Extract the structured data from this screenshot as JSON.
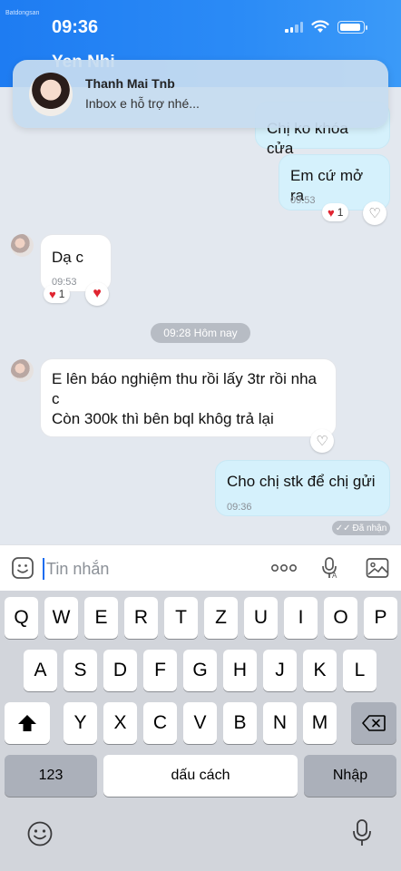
{
  "status_bar": {
    "brand": "Batdongsan",
    "time": "09:36"
  },
  "header": {
    "title": "Yen Nhi"
  },
  "notification": {
    "sender": "Thanh Mai Tnb",
    "preview": "Inbox e hỗ trợ nhé..."
  },
  "messages": {
    "m1": {
      "text": "Chị ko khóa cửa"
    },
    "m2": {
      "text": "Em cứ mở ra",
      "time": "09:53",
      "reaction_count": "1"
    },
    "m3": {
      "text": "Dạ c",
      "time": "09:53",
      "reaction_count": "1"
    },
    "date_divider": "09:28 Hôm nay",
    "m4": {
      "line1": "E lên báo nghiệm thu rồi lấy 3tr rồi nha",
      "line2": "c",
      "line3": "Còn 300k thì bên bql khôg trả lại"
    },
    "m5": {
      "text": "Cho chị stk để chị gửi",
      "time": "09:36"
    },
    "seen_label": "Đã nhận"
  },
  "input": {
    "placeholder": "Tin nhắn"
  },
  "keyboard": {
    "row1": [
      "Q",
      "W",
      "E",
      "R",
      "T",
      "Z",
      "U",
      "I",
      "O",
      "P"
    ],
    "row2": [
      "A",
      "S",
      "D",
      "F",
      "G",
      "H",
      "J",
      "K",
      "L"
    ],
    "row3": [
      "Y",
      "X",
      "C",
      "V",
      "B",
      "N",
      "M"
    ],
    "numbers_key": "123",
    "space_key": "dấu cách",
    "return_key": "Nhập"
  },
  "colors": {
    "header_blue": "#1e7cf2",
    "outgoing_bubble": "#d5f1fc",
    "incoming_bubble": "#ffffff",
    "heart": "#e02430"
  }
}
